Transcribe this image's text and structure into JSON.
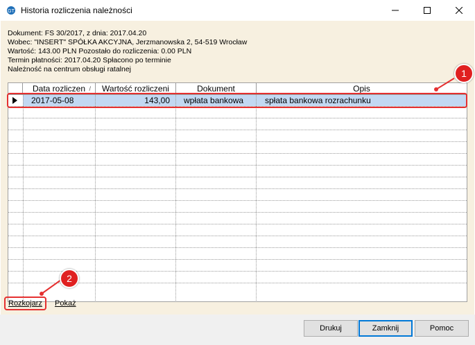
{
  "window": {
    "title": "Historia rozliczenia należności"
  },
  "info": {
    "line1": "Dokument: FS 30/2017, z dnia: 2017.04.20",
    "line2": "Wobec: \"INSERT\" SPÓŁKA AKCYJNA, Jerzmanowska 2, 54-519 Wrocław",
    "line3": "Wartość: 143.00 PLN Pozostało do rozliczenia: 0.00 PLN",
    "line4": "Termin płatności: 2017.04.20 Spłacono po terminie",
    "line5": "Należność na centrum obsługi ratalnej"
  },
  "grid": {
    "columns": [
      "Data rozliczen",
      "Wartość rozliczeni",
      "Dokument",
      "Opis"
    ],
    "rows": [
      {
        "date": "2017-05-08",
        "value": "143,00",
        "document": "wpłata bankowa",
        "description": "spłata bankowa rozrachunku"
      }
    ],
    "sort_indicator": "/"
  },
  "links": {
    "rozkojarz": "Rozkojarz",
    "pokaz": "Pokaż"
  },
  "buttons": {
    "print": "Drukuj",
    "close": "Zamknij",
    "help": "Pomoc"
  },
  "callouts": {
    "one": "1",
    "two": "2"
  },
  "colors": {
    "accent_red": "#e53030",
    "selection": "#c2d8f2",
    "client_bg": "#f7f0e0"
  },
  "icons": [
    "app-icon",
    "minimize-icon",
    "maximize-icon",
    "close-icon",
    "row-pointer-icon"
  ]
}
